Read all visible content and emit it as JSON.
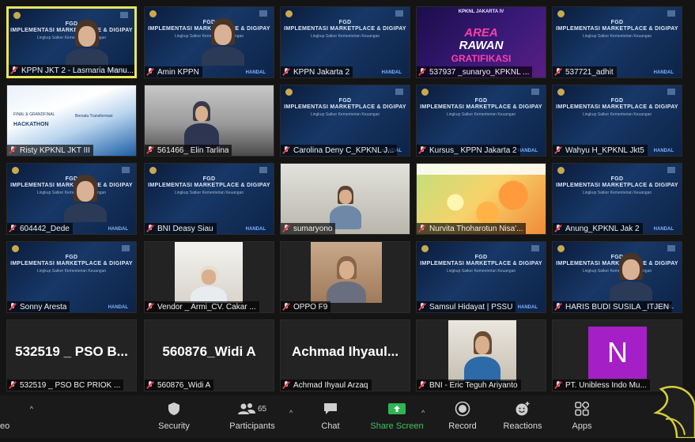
{
  "participants": [
    {
      "name": "KPPN JKT 2 - Lasmaria Manu...",
      "type": "video-slide",
      "active": true
    },
    {
      "name": "Amin KPPN",
      "type": "video-slide"
    },
    {
      "name": "KPPN Jakarta 2",
      "type": "slide"
    },
    {
      "name": "537937 _sunaryo_KPKNL ...",
      "type": "banner",
      "banner": {
        "org": "KPKNL JAKARTA IV",
        "line1": "AREA",
        "line2": "RAWAN",
        "line3": "GRATIFIKASI"
      }
    },
    {
      "name": "537721_adhit",
      "type": "slide"
    },
    {
      "name": "Risty KPKNL JKT III",
      "type": "hackathon"
    },
    {
      "name": "561466_ Elin Tarlina",
      "type": "camera"
    },
    {
      "name": "Carolina Deny C_KPKNL J...",
      "type": "slide"
    },
    {
      "name": "Kursus_ KPPN Jakarta 2",
      "type": "slide"
    },
    {
      "name": "Wahyu H_KPKNL Jkt5",
      "type": "slide"
    },
    {
      "name": "604442_Dede",
      "type": "video-slide"
    },
    {
      "name": "BNI Deasy Siau",
      "type": "slide"
    },
    {
      "name": "sumaryono",
      "type": "camera"
    },
    {
      "name": "Nurvita Thoharotun Nisa'...",
      "type": "flowers"
    },
    {
      "name": "Anung_KPKNL Jak 2",
      "type": "slide"
    },
    {
      "name": "Sonny Aresta",
      "type": "slide"
    },
    {
      "name": "Vendor _ Armi_CV. Cakar ...",
      "type": "camera"
    },
    {
      "name": "OPPO F9",
      "type": "camera"
    },
    {
      "name": "Samsul Hidayat | PSSU",
      "type": "slide"
    },
    {
      "name": "HARIS BUDI SUSILA _ITJEN",
      "type": "video-slide"
    },
    {
      "name": "532519 _ PSO BC PRIOK ...",
      "type": "text",
      "display": "532519 _ PSO B..."
    },
    {
      "name": "560876_Widi A",
      "type": "text",
      "display": "560876_Widi A"
    },
    {
      "name": "Achmad Ihyaul Arzaq",
      "type": "text",
      "display": "Achmad Ihyaul..."
    },
    {
      "name": "BNI - Eric Teguh Ariyanto",
      "type": "camera"
    },
    {
      "name": "PT. Unibless Indo Mu...",
      "type": "avatar",
      "initial": "N"
    }
  ],
  "slide": {
    "title_line1": "FGD",
    "title_line2": "IMPLEMENTASI MARKETPLACE & DIGIPAY",
    "subtitle": "Lingkup Satker Kementerian Keuangan",
    "brand": "HANDAL"
  },
  "hackathon": {
    "line1": "FINAL & GRANDFINAL",
    "line2": "HACKATHON",
    "line3": "Bersatu Transformasi"
  },
  "toolbar": {
    "video_label": "eo",
    "security": "Security",
    "participants": "Participants",
    "participants_count": "65",
    "chat": "Chat",
    "share": "Share Screen",
    "record": "Record",
    "reactions": "Reactions",
    "apps": "Apps"
  },
  "colors": {
    "accent_green": "#3ec462",
    "active_border": "#e8e65a",
    "muted_red": "#e0383e",
    "avatar_purple": "#a41fc6"
  }
}
